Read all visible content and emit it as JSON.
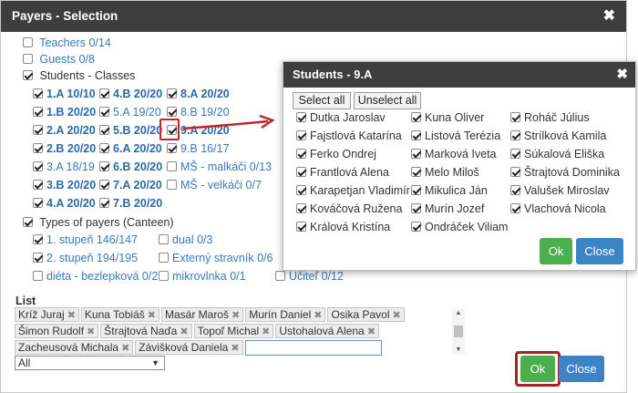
{
  "main": {
    "title": "Payers - Selection",
    "close": "✖",
    "sections": {
      "teachers": "Teachers 0/14",
      "guests": "Guests 0/8",
      "students": "Students - Classes",
      "types": "Types of payers (Canteen)"
    },
    "classes": [
      [
        "1.A 10/10",
        "4.B 20/20",
        "8.A 20/20"
      ],
      [
        "1.B 20/20",
        "5.A 19/20",
        "8.B 19/20"
      ],
      [
        "2.A 20/20",
        "5.B 20/20",
        "9.A 20/20"
      ],
      [
        "2.B 20/20",
        "6.A 20/20",
        "9.B 16/17"
      ],
      [
        "3.A 18/19",
        "6.B 20/20",
        "MŠ - malkáči 0/13"
      ],
      [
        "3.B 20/20",
        "7.A 20/20",
        "MŠ - velkáči 0/7"
      ],
      [
        "4.A 20/20",
        "7.B 20/20"
      ]
    ],
    "types": [
      [
        "1. stupeň 146/147",
        "dual 0/3",
        ""
      ],
      [
        "2. stupeň 194/195",
        "Externý stravník 0/6",
        ""
      ],
      [
        "diéta - bezlepková 0/2",
        "mikrovlnka 0/1",
        "Učiteľ 0/12"
      ]
    ],
    "list_label": "List",
    "tags": [
      "Kríž Juraj",
      "Kuna Tobiáš",
      "Masár Maroš",
      "Murín Daniel",
      "Osika Pavol",
      "Šimon Rudolf",
      "Štrajtová Naďa",
      "Topoľ Michal",
      "Ustohalová Alena",
      "Zacheusová Michala",
      "Závišková Daniela"
    ],
    "tag_remove": "✖",
    "select_value": "All",
    "select_caret": "▼",
    "ok": "Ok",
    "close_btn": "Close"
  },
  "popup": {
    "title": "Students - 9.A",
    "close": "✖",
    "select_all": "Select all",
    "unselect_all": "Unselect all",
    "students": [
      [
        "Dutka Jaroslav",
        "Kuna Oliver",
        "Roháč Július"
      ],
      [
        "Fajstlová Katarína",
        "Listová Terézia",
        "Strílková Kamila"
      ],
      [
        "Ferko Ondrej",
        "Marková Iveta",
        "Súkalová Eliška"
      ],
      [
        "Frantlová Alena",
        "Melo Miloš",
        "Štrajtová Dominika"
      ],
      [
        "Karapetjan Vladimír",
        "Mikulica Ján",
        "Valušek Miroslav"
      ],
      [
        "Kováčová Ružena",
        "Murín Jozef",
        "Vlachová Nicola"
      ],
      [
        "Králová Kristína",
        "Ondráček Viliam"
      ]
    ],
    "ok": "Ok",
    "close_btn": "Close"
  },
  "colors": {
    "title_bar": "#3e3e3e",
    "link": "#3b79b7",
    "ok": "#4cae4c",
    "close": "#3d84c6",
    "highlight": "#c02628"
  }
}
